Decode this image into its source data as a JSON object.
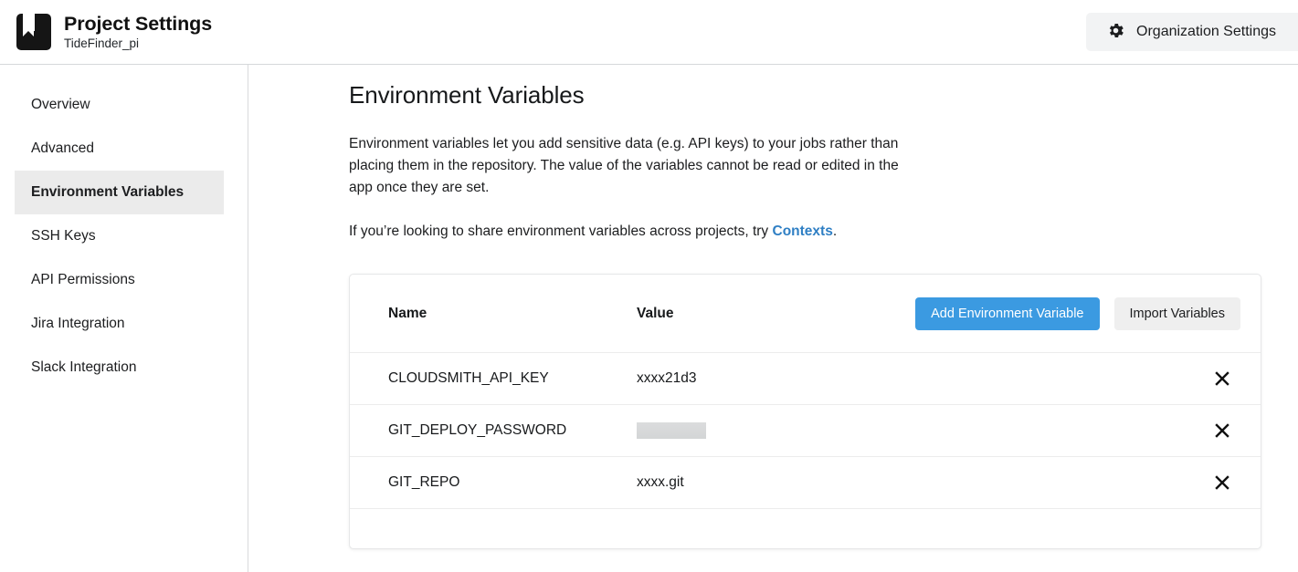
{
  "header": {
    "logo_icon": "bookmark-icon",
    "title": "Project Settings",
    "subtitle": "TideFinder_pi",
    "org_settings": {
      "icon": "gear-icon",
      "label": "Organization Settings"
    }
  },
  "sidebar": {
    "items": [
      {
        "label": "Overview",
        "active": false
      },
      {
        "label": "Advanced",
        "active": false
      },
      {
        "label": "Environment Variables",
        "active": true
      },
      {
        "label": "SSH Keys",
        "active": false
      },
      {
        "label": "API Permissions",
        "active": false
      },
      {
        "label": "Jira Integration",
        "active": false
      },
      {
        "label": "Slack Integration",
        "active": false
      }
    ]
  },
  "main": {
    "title": "Environment Variables",
    "paragraph_1": "Environment variables let you add sensitive data (e.g. API keys) to your jobs rather than placing them in the repository. The value of the variables cannot be read or edited in the app once they are set.",
    "paragraph_2_before": "If you’re looking to share environment variables across projects, try ",
    "paragraph_2_link": "Contexts",
    "paragraph_2_after": ".",
    "table": {
      "columns": [
        "Name",
        "Value"
      ],
      "actions": {
        "add_label": "Add Environment Variable",
        "import_label": "Import Variables"
      },
      "rows": [
        {
          "name": "CLOUDSMITH_API_KEY",
          "value": "xxxx21d3",
          "redacted": false,
          "delete_icon": "close-icon"
        },
        {
          "name": "GIT_DEPLOY_PASSWORD",
          "value": "",
          "redacted": true,
          "delete_icon": "close-icon"
        },
        {
          "name": "GIT_REPO",
          "value": "xxxx.git",
          "redacted": false,
          "delete_icon": "close-icon"
        }
      ]
    }
  },
  "colors": {
    "primary_button": "#3b9ae1",
    "link": "#2f7fc4",
    "active_nav_bg": "#ebebeb",
    "secondary_button": "#efefef"
  }
}
